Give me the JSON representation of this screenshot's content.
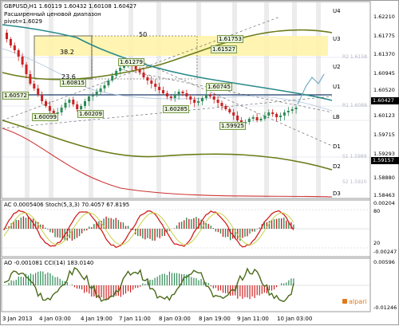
{
  "main": {
    "symbol": "GBPUSD,H1",
    "ohlc": "1.60119 1.60432 1.60108 1.60427",
    "indicator_title": "Расширенный ценовой диапазон",
    "indicator_sub": "pivot=1.6029",
    "fib": [
      "38.2",
      "23.6",
      "50"
    ],
    "price_labels": [
      "1.60572",
      "1.61279",
      "1.61753",
      "1.61527",
      "1.60815",
      "1.60099",
      "1.60209",
      "1.60285",
      "1.60745",
      "1.59925"
    ],
    "levels": [
      "U4",
      "U3",
      "U2",
      "U1",
      "LB",
      "D1",
      "D2",
      "D3"
    ],
    "faint_levels": [
      "R2 1.6158",
      "R1 1.6088",
      "S1 1.5989",
      "S2 1.5920"
    ],
    "scale": [
      "1.62210",
      "1.61775",
      "1.61370",
      "1.60945",
      "1.60520",
      "1.60123",
      "1.59715",
      "1.59293",
      "1.58880",
      "1.58463"
    ],
    "current_price": "1.60427",
    "low_marker": "1.59157"
  },
  "ac": {
    "title": "AC 0.0005406  Stoch(5,3,3) 70.4057 67.8195",
    "scale": [
      "0.00204",
      "80",
      "20",
      "-0.00247"
    ]
  },
  "ao": {
    "title": "AO -0.001081  CCI(14) 183.0140",
    "scale": [
      "0.00596",
      "-0.01246"
    ]
  },
  "time_axis": [
    "3 Jan 2013",
    "4 Jan 03:00",
    "4 Jan 19:00",
    "7 Jan 11:00",
    "8 Jan 03:00",
    "8 Jan 19:00",
    "9 Jan 11:00",
    "10 Jan 03:00"
  ],
  "watermark": "alpari",
  "colors": {
    "bull": "#2e8b57",
    "bear": "#cc2222",
    "olive": "#6b7d1a",
    "teal": "#2a8a8a",
    "zone": "#fff3a8"
  }
}
